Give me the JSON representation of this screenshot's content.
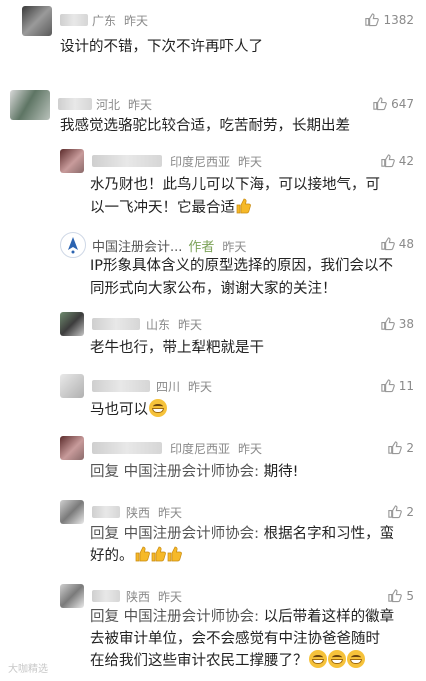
{
  "comments": [
    {
      "location": "广东",
      "time": "昨天",
      "likes": "1382",
      "text": "设计的不错，下次不许再吓人了"
    },
    {
      "location": "河北",
      "time": "昨天",
      "likes": "647",
      "text": "我感觉选骆驼比较合适，吃苦耐劳，长期出差"
    },
    {
      "location": "印度尼西亚",
      "time": "昨天",
      "likes": "42",
      "text_l1": "水乃财也！此鸟儿可以下海，可以接地气，可",
      "text_l2": "以一飞冲天！它最合适"
    },
    {
      "name": "中国注册会计...",
      "badge": "作者",
      "time": "昨天",
      "likes": "48",
      "text_l1": "IP形象具体含义的原型选择的原因，我们会以不",
      "text_l2": "同形式向大家公布，谢谢大家的关注！"
    },
    {
      "location": "山东",
      "time": "昨天",
      "likes": "38",
      "text": "老牛也行，带上犁粑就是干"
    },
    {
      "location": "四川",
      "time": "昨天",
      "likes": "11",
      "text": "马也可以"
    },
    {
      "location": "印度尼西亚",
      "time": "昨天",
      "likes": "2",
      "reply_prefix": "回复 中国注册会计师协会:",
      "text": " 期待!"
    },
    {
      "location": "陕西",
      "time": "昨天",
      "likes": "2",
      "reply_prefix": "回复 中国注册会计师协会:",
      "text_l1": " 根据名字和习性，蛮",
      "text_l2": "好的。"
    },
    {
      "location": "陕西",
      "time": "昨天",
      "likes": "5",
      "reply_prefix": "回复 中国注册会计师协会:",
      "text_l1": " 以后带着这样的徽章",
      "text_l2": "去被审计单位，会不会感觉有中注协爸爸随时",
      "text_l3": "在给我们这些审计农民工撑腰了？"
    }
  ],
  "watermark": "大咖精选",
  "icons": {
    "like": "thumbs-up-icon",
    "thumb_emoji": "thumbs-up-emoji-icon",
    "grin_emoji": "grinning-emoji-icon"
  }
}
